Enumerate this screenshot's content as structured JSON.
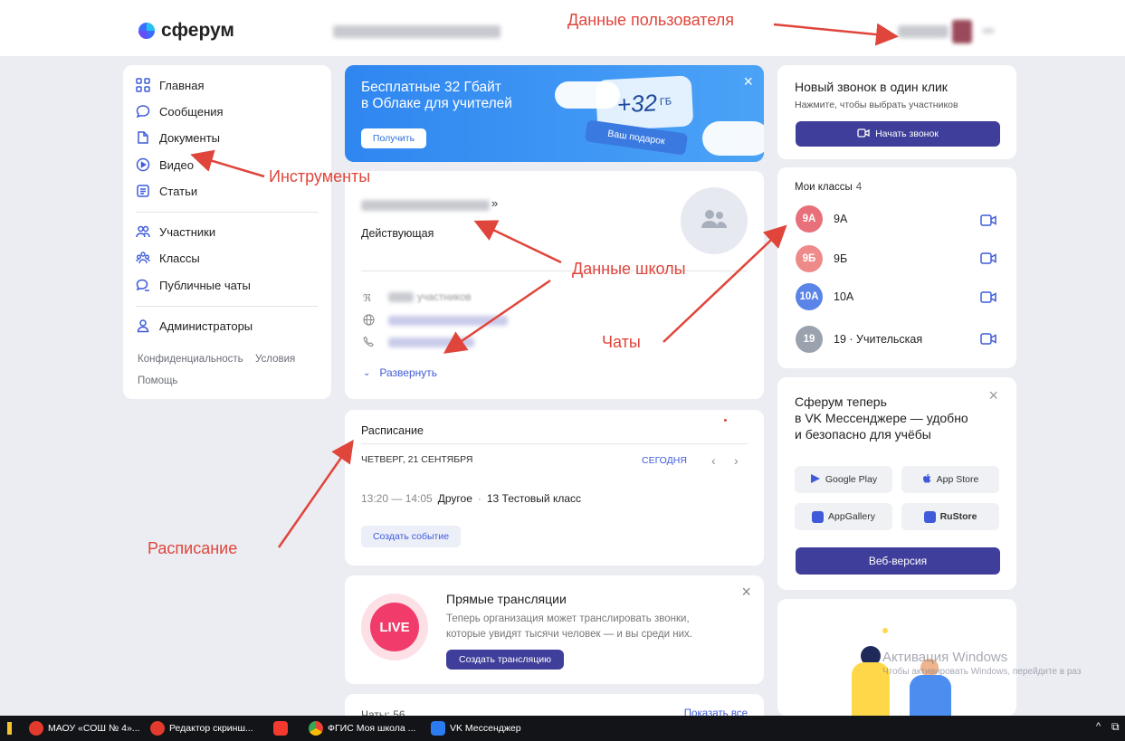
{
  "header": {
    "logo_text": "сферум",
    "brand_color": "#4b5cff"
  },
  "annotations": {
    "user_data": "Данные пользователя",
    "tools": "Инструменты",
    "school_data": "Данные школы",
    "chats": "Чаты",
    "schedule": "Расписание",
    "color": "#e0453b"
  },
  "sidebar": {
    "items": [
      {
        "label": "Главная",
        "icon": "grid-icon"
      },
      {
        "label": "Сообщения",
        "icon": "chat-bubble-icon"
      },
      {
        "label": "Документы",
        "icon": "document-icon"
      },
      {
        "label": "Видео",
        "icon": "play-circle-icon"
      },
      {
        "label": "Статьи",
        "icon": "article-icon"
      },
      {
        "label": "Участники",
        "icon": "people-icon"
      },
      {
        "label": "Классы",
        "icon": "class-group-icon"
      },
      {
        "label": "Публичные чаты",
        "icon": "public-chat-icon"
      },
      {
        "label": "Администраторы",
        "icon": "person-icon"
      }
    ],
    "footer_links": [
      "Конфиденциальность",
      "Условия",
      "Помощь"
    ]
  },
  "promo": {
    "title_line1": "Бесплатные 32 Гбайт",
    "title_line2": "в Облаке для учителей",
    "button": "Получить",
    "badge_value": "+32",
    "badge_unit": "ГБ",
    "gift_label": "Ваш подарок",
    "close": "×"
  },
  "school": {
    "status": "Действующая",
    "members_suffix": "участников",
    "expand": "Развернуть"
  },
  "schedule": {
    "title": "Расписание",
    "date": "ЧЕТВЕРГ, 21 СЕНТЯБРЯ",
    "today": "СЕГОДНЯ",
    "event_time": "13:20 — 14:05",
    "event_type": "Другое",
    "event_class": "13 Тестовый класс",
    "create_button": "Создать событие"
  },
  "live": {
    "badge": "LIVE",
    "title": "Прямые трансляции",
    "desc_line1": "Теперь организация может транслировать звонки,",
    "desc_line2": "которые увидят тысячи человек — и вы среди них.",
    "button": "Создать трансляцию",
    "close": "×"
  },
  "chats_preview": {
    "title": "Чаты: 56",
    "show_all": "Показать все"
  },
  "call": {
    "title": "Новый звонок в один клик",
    "subtitle": "Нажмите, чтобы выбрать участников",
    "button": "Начать звонок"
  },
  "classes": {
    "title": "Мои классы",
    "count": "4",
    "items": [
      {
        "avatar": "9А",
        "name": "9А",
        "color": "#e8707a"
      },
      {
        "avatar": "9Б",
        "name": "9Б",
        "color": "#ef8a8a"
      },
      {
        "avatar": "10А",
        "name": "10А",
        "color": "#5a84e8"
      },
      {
        "avatar": "19",
        "name": "19 · Учительская",
        "color": "#9aa2ad"
      }
    ]
  },
  "vk": {
    "title_line1": "Сферум теперь",
    "title_line2": "в VK Мессенджере — удобно",
    "title_line3": "и безопасно для учёбы",
    "stores": [
      "Google Play",
      "App Store",
      "AppGallery",
      "RuStore"
    ],
    "web_button": "Веб-версия",
    "close": "×"
  },
  "watermark": {
    "line1": "Активация Windows",
    "line2": "Чтобы активировать Windows, перейдите в раз"
  },
  "taskbar": {
    "items": [
      {
        "label": "МАОУ «СОШ № 4»...",
        "icon": "yandex-browser-icon"
      },
      {
        "label": "Редактор скринш...",
        "icon": "yandex-browser-icon"
      },
      {
        "label": "",
        "icon": "yandex-icon"
      },
      {
        "label": "ФГИС Моя школа ...",
        "icon": "chrome-icon"
      },
      {
        "label": "VK Мессенджер",
        "icon": "vk-messenger-icon"
      }
    ]
  }
}
